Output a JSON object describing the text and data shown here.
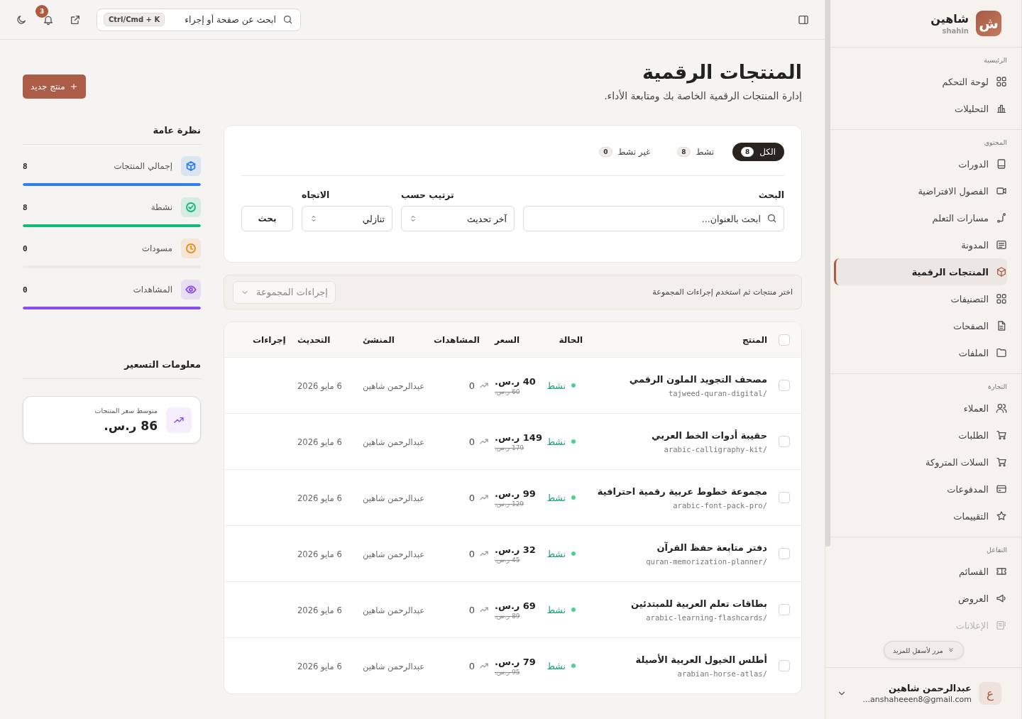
{
  "sidebar": {
    "brand": {
      "initial": "ش",
      "name": "شاهين",
      "subtitle": "shahin"
    },
    "sections": [
      {
        "title": "الرئيسية",
        "items": [
          {
            "label": "لوحة التحكم",
            "selected": false
          },
          {
            "label": "التحليلات",
            "selected": false
          }
        ]
      },
      {
        "title": "المحتوى",
        "items": [
          {
            "label": "الدورات",
            "selected": false
          },
          {
            "label": "الفصول الافتراضية",
            "selected": false
          },
          {
            "label": "مسارات التعلم",
            "selected": false
          },
          {
            "label": "المدونة",
            "selected": false
          },
          {
            "label": "المنتجات الرقمية",
            "selected": true
          },
          {
            "label": "التصنيفات",
            "selected": false
          },
          {
            "label": "الصفحات",
            "selected": false
          },
          {
            "label": "الملفات",
            "selected": false
          }
        ]
      },
      {
        "title": "التجارة",
        "items": [
          {
            "label": "العملاء",
            "selected": false
          },
          {
            "label": "الطلبات",
            "selected": false
          },
          {
            "label": "السلات المتروكة",
            "selected": false
          },
          {
            "label": "المدفوعات",
            "selected": false
          },
          {
            "label": "التقييمات",
            "selected": false
          }
        ]
      },
      {
        "title": "التفاعل",
        "items": [
          {
            "label": "القسائم",
            "selected": false
          },
          {
            "label": "العروض",
            "selected": false
          },
          {
            "label": "الإعلانات",
            "selected": false,
            "faded": true
          }
        ]
      }
    ],
    "scroll_hint": "مرر لأسفل للمزيد",
    "user": {
      "initial": "ع",
      "name": "عبدالرحمن شاهين",
      "email": "...anshaheeen8@gmail.com"
    }
  },
  "topbar": {
    "search": {
      "placeholder": "ابحث عن صفحة أو إجراء",
      "shortcut": "Ctrl/Cmd + K"
    },
    "notifications": "3"
  },
  "page": {
    "title": "المنتجات الرقمية",
    "subtitle": "إدارة المنتجات الرقمية الخاصة بك ومتابعة الأداء.",
    "new_button": "منتج جديد"
  },
  "filters": {
    "tabs": [
      {
        "label": "الكل",
        "count": "8",
        "selected": true
      },
      {
        "label": "نشط",
        "count": "8",
        "selected": false
      },
      {
        "label": "غير نشط",
        "count": "0",
        "selected": false
      }
    ],
    "search": {
      "label": "البحث",
      "placeholder": "ابحث بالعنوان..."
    },
    "sort": {
      "label": "ترتيب حسب",
      "value": "آخر تحديث"
    },
    "direction": {
      "label": "الاتجاه",
      "value": "تنازلي"
    },
    "submit": "بحث"
  },
  "bulk": {
    "hint": "اختر منتجات ثم استخدم إجراءات المجموعة",
    "button": "إجراءات المجموعة"
  },
  "table": {
    "select_all": false,
    "columns": [
      "المنتج",
      "الحالة",
      "السعر",
      "المشاهدات",
      "المنشئ",
      "التحديث",
      "إجراءات"
    ],
    "rows": [
      {
        "name": "مصحف التجويد الملون الرقمي",
        "slug": "/tajweed-quran-digital",
        "status": "نشط",
        "price": "40 ر.س.",
        "old_price": "60 ر.س.",
        "views": "0",
        "creator": "عبدالرحمن شاهين",
        "updated": "6 مايو 2026",
        "checked": false
      },
      {
        "name": "حقيبة أدوات الخط العربي",
        "slug": "/arabic-calligraphy-kit",
        "status": "نشط",
        "price": "149 ر.س.",
        "old_price": "179 ر.س.",
        "views": "0",
        "creator": "عبدالرحمن شاهين",
        "updated": "6 مايو 2026",
        "checked": false
      },
      {
        "name": "مجموعة خطوط عربية رقمية احترافية",
        "slug": "/arabic-font-pack-pro",
        "status": "نشط",
        "price": "99 ر.س.",
        "old_price": "129 ر.س.",
        "views": "0",
        "creator": "عبدالرحمن شاهين",
        "updated": "6 مايو 2026",
        "checked": false
      },
      {
        "name": "دفتر متابعة حفظ القرآن",
        "slug": "/quran-memorization-planner",
        "status": "نشط",
        "price": "32 ر.س.",
        "old_price": "45 ر.س.",
        "views": "0",
        "creator": "عبدالرحمن شاهين",
        "updated": "6 مايو 2026",
        "checked": false
      },
      {
        "name": "بطاقات تعلم العربية للمبتدئين",
        "slug": "/arabic-learning-flashcards",
        "status": "نشط",
        "price": "69 ر.س.",
        "old_price": "89 ر.س.",
        "views": "0",
        "creator": "عبدالرحمن شاهين",
        "updated": "6 مايو 2026",
        "checked": false
      },
      {
        "name": "أطلس الخيول العربية الأصيلة",
        "slug": "/arabian-horse-atlas",
        "status": "نشط",
        "price": "79 ر.س.",
        "old_price": "95 ر.س.",
        "views": "0",
        "creator": "عبدالرحمن شاهين",
        "updated": "6 مايو 2026",
        "checked": false
      }
    ]
  },
  "overview": {
    "title": "نظرة عامة",
    "stats": [
      {
        "label": "إجمالي المنتجات",
        "value": "8",
        "color": "#2f7ff0",
        "level": 1
      },
      {
        "label": "نشطة",
        "value": "8",
        "color": "#12b97a",
        "level": 1
      },
      {
        "label": "مسودات",
        "value": "0",
        "color": "#f08c1e",
        "level": 0
      },
      {
        "label": "المشاهدات",
        "value": "0",
        "color": "#8b4cf0",
        "level": 1
      }
    ]
  },
  "pricing": {
    "title": "معلومات التسعير",
    "label": "متوسط سعر المنتجات",
    "value": "86 ر.س."
  }
}
